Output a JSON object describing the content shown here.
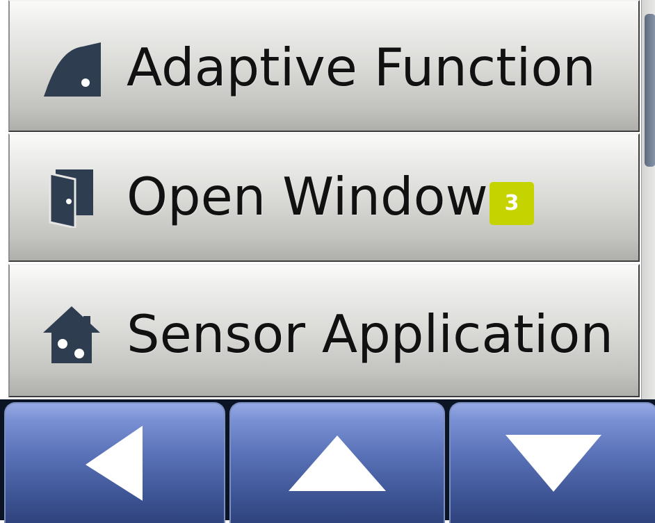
{
  "menu": {
    "items": [
      {
        "label": "Adaptive Function",
        "icon": "adaptive-curve-icon"
      },
      {
        "label": "Open Window",
        "icon": "open-window-door-icon",
        "badge": "3"
      },
      {
        "label": "Sensor Application",
        "icon": "house-sensor-icon"
      }
    ]
  },
  "nav": {
    "back_icon": "arrow-left-icon",
    "up_icon": "arrow-up-icon",
    "down_icon": "arrow-down-icon"
  },
  "colors": {
    "badge": "#c5d400",
    "icon": "#2e3d4f",
    "nav_button": "#5a72b8"
  }
}
